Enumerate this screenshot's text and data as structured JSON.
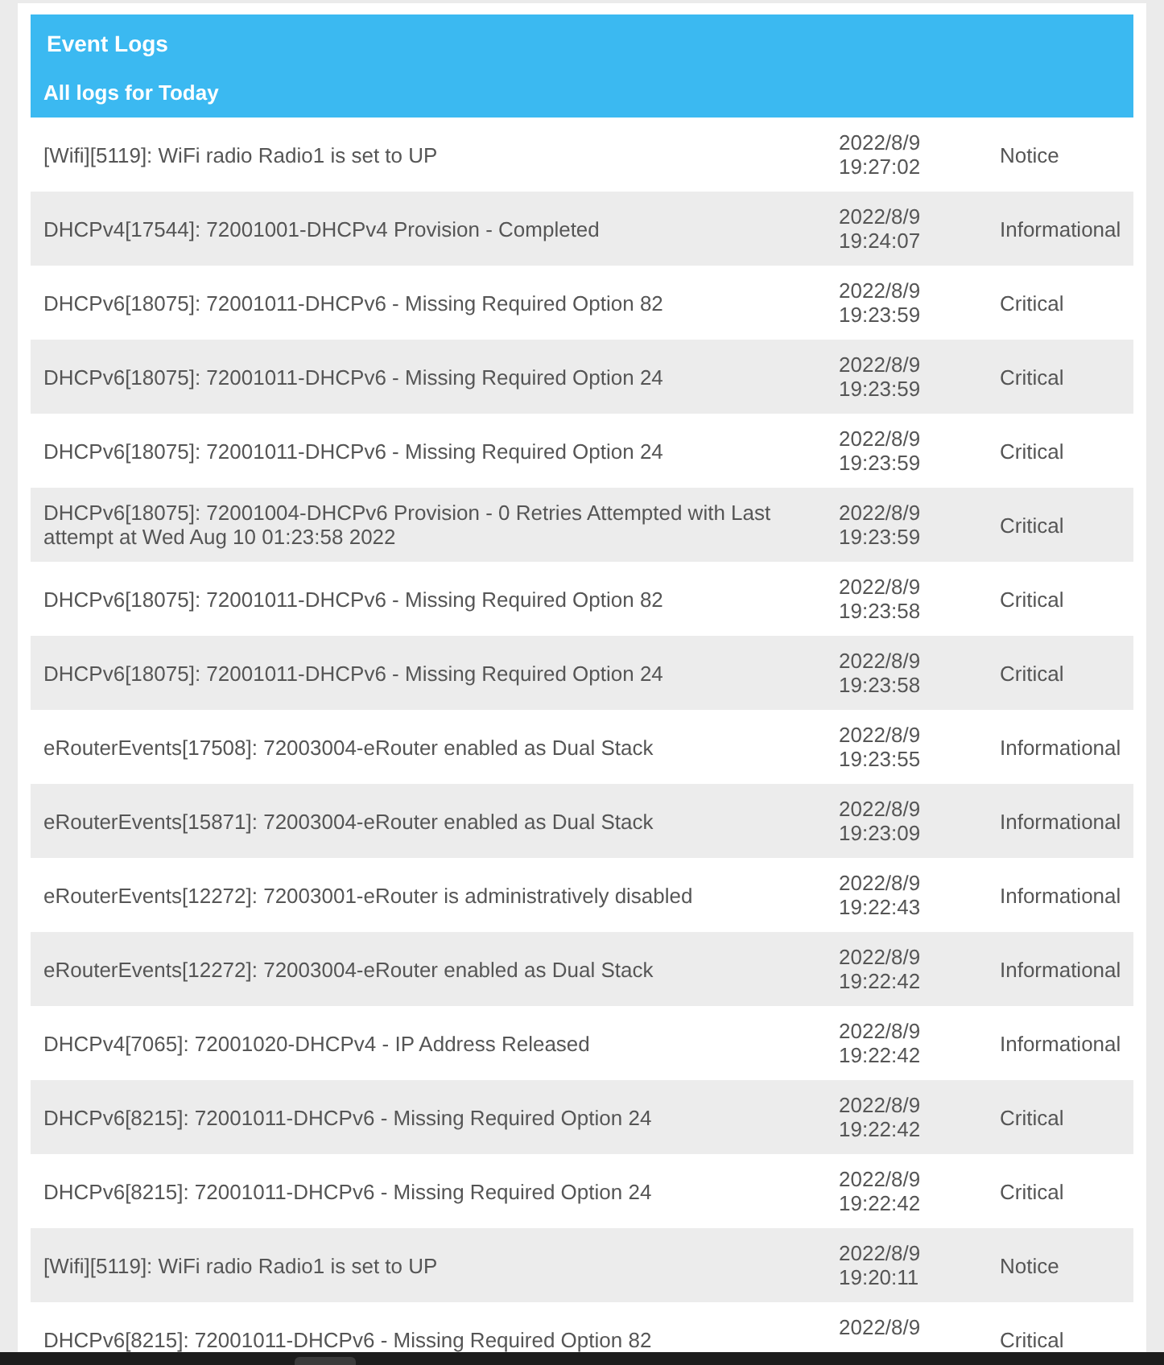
{
  "panel": {
    "title": "Event Logs",
    "subtitle": "All logs for Today"
  },
  "table": {
    "rows": [
      {
        "message": "[Wifi][5119]: WiFi radio Radio1 is set to UP",
        "date": "2022/8/9",
        "time": "19:27:02",
        "level": "Notice"
      },
      {
        "message": "DHCPv4[17544]: 72001001-DHCPv4 Provision - Completed",
        "date": "2022/8/9",
        "time": "19:24:07",
        "level": "Informational"
      },
      {
        "message": "DHCPv6[18075]: 72001011-DHCPv6 - Missing Required Option 82",
        "date": "2022/8/9",
        "time": "19:23:59",
        "level": "Critical"
      },
      {
        "message": "DHCPv6[18075]: 72001011-DHCPv6 - Missing Required Option 24",
        "date": "2022/8/9",
        "time": "19:23:59",
        "level": "Critical"
      },
      {
        "message": "DHCPv6[18075]: 72001011-DHCPv6 - Missing Required Option 24",
        "date": "2022/8/9",
        "time": "19:23:59",
        "level": "Critical"
      },
      {
        "message": "DHCPv6[18075]: 72001004-DHCPv6 Provision - 0 Retries Attempted with Last attempt at Wed Aug 10 01:23:58 2022",
        "date": "2022/8/9",
        "time": "19:23:59",
        "level": "Critical"
      },
      {
        "message": "DHCPv6[18075]: 72001011-DHCPv6 - Missing Required Option 82",
        "date": "2022/8/9",
        "time": "19:23:58",
        "level": "Critical"
      },
      {
        "message": "DHCPv6[18075]: 72001011-DHCPv6 - Missing Required Option 24",
        "date": "2022/8/9",
        "time": "19:23:58",
        "level": "Critical"
      },
      {
        "message": "eRouterEvents[17508]: 72003004-eRouter enabled as Dual Stack",
        "date": "2022/8/9",
        "time": "19:23:55",
        "level": "Informational"
      },
      {
        "message": "eRouterEvents[15871]: 72003004-eRouter enabled as Dual Stack",
        "date": "2022/8/9",
        "time": "19:23:09",
        "level": "Informational"
      },
      {
        "message": "eRouterEvents[12272]: 72003001-eRouter is administratively disabled",
        "date": "2022/8/9",
        "time": "19:22:43",
        "level": "Informational"
      },
      {
        "message": "eRouterEvents[12272]: 72003004-eRouter enabled as Dual Stack",
        "date": "2022/8/9",
        "time": "19:22:42",
        "level": "Informational"
      },
      {
        "message": "DHCPv4[7065]: 72001020-DHCPv4 - IP Address Released",
        "date": "2022/8/9",
        "time": "19:22:42",
        "level": "Informational"
      },
      {
        "message": "DHCPv6[8215]: 72001011-DHCPv6 - Missing Required Option 24",
        "date": "2022/8/9",
        "time": "19:22:42",
        "level": "Critical"
      },
      {
        "message": "DHCPv6[8215]: 72001011-DHCPv6 - Missing Required Option 24",
        "date": "2022/8/9",
        "time": "19:22:42",
        "level": "Critical"
      },
      {
        "message": "[Wifi][5119]: WiFi radio Radio1 is set to UP",
        "date": "2022/8/9",
        "time": "19:20:11",
        "level": "Notice"
      },
      {
        "message": "DHCPv6[8215]: 72001011-DHCPv6 - Missing Required Option 82",
        "date": "2022/8/9",
        "level": "Critical"
      }
    ]
  }
}
